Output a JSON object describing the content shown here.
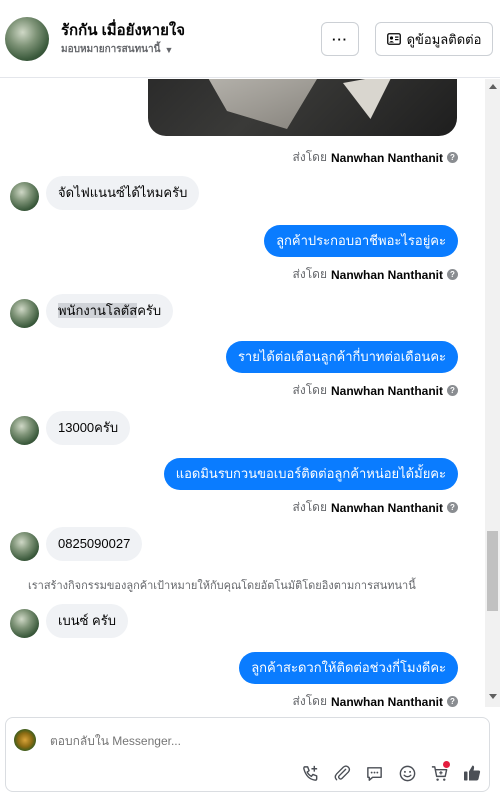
{
  "header": {
    "title": "รักกัน เมื่อยังหายใจ",
    "subtitle": "มอบหมายการสนทนานี้",
    "more_label": "···",
    "contact_label": "ดูข้อมูลติดต่อ"
  },
  "messages": {
    "sent_by_prefix": "ส่งโดย",
    "agent_name": "Nanwhan Nanthanit",
    "in_1": "จัดไฟแนนซ์ได้ไหมครับ",
    "out_1": "ลูกค้าประกอบอาชีพอะไรอยู่คะ",
    "in_2_highlight": "พนักงานโลตัส",
    "in_2_rest": "ครับ",
    "out_2": "รายได้ต่อเดือนลูกค้ากี่บาทต่อเดือนคะ",
    "in_3": "13000ครับ",
    "out_3": "แอดมินรบกวนขอเบอร์ติดต่อลูกค้าหน่อยได้มั้ยคะ",
    "in_4": "0825090027",
    "system_note": "เราสร้างกิจกรรมของลูกค้าเป้าหมายให้กับคุณโดยอัตโนมัติโดยอิงตามการสนทนานี้",
    "in_5": "เบนซ์ ครับ",
    "out_4": "ลูกค้าสะดวกให้ติดต่อช่วงกี่โมงดีคะ"
  },
  "composer": {
    "placeholder": "ตอบกลับใน Messenger..."
  },
  "icons": {
    "call": "phone-add-icon",
    "attach": "paperclip-icon",
    "saved_replies": "chat-bubble-icon",
    "emoji": "emoji-icon",
    "cart": "cart-icon",
    "like": "thumbs-up-icon"
  },
  "colors": {
    "accent": "#0a7cff",
    "incoming_bubble": "#f0f2f5",
    "notification": "#e41e3f"
  }
}
